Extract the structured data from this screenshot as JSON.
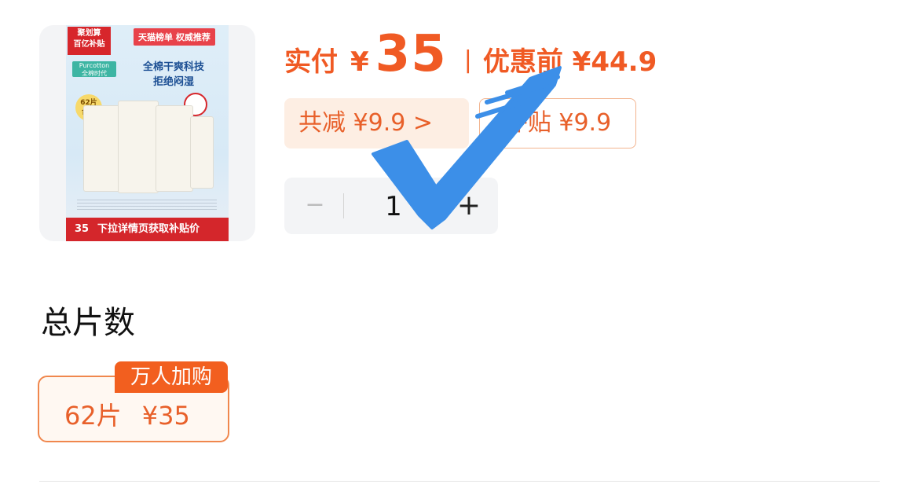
{
  "product": {
    "image": {
      "ribbon_text": "聚划算\n百亿补贴",
      "top_tag": "天猫榜单 权威推荐",
      "brand": "Purcotton\n全棉时代",
      "slogan_line1": "全棉干爽科技",
      "slogan_line2": "拒绝闷湿",
      "count_badge": "62片\n合计",
      "bottom_number": "35",
      "bottom_text": "下拉详情页获取补贴价"
    }
  },
  "price": {
    "paid_label": "实付",
    "currency": "¥",
    "paid_value": "35",
    "separator": "|",
    "original_text": "优惠前 ¥44.9"
  },
  "discount": {
    "total_text": "共减 ¥9.9 >",
    "subsidy_text": "补贴 ¥9.9"
  },
  "stepper": {
    "minus": "−",
    "quantity": "1",
    "plus": "+"
  },
  "section": {
    "title": "总片数"
  },
  "option": {
    "badge": "万人加购",
    "count": "62片",
    "price": "¥35"
  },
  "colors": {
    "accent": "#f05a24",
    "chip_bg": "#fdeee3",
    "check": "#3c8fe8"
  },
  "overlay": {
    "icon": "checkmark-icon"
  }
}
